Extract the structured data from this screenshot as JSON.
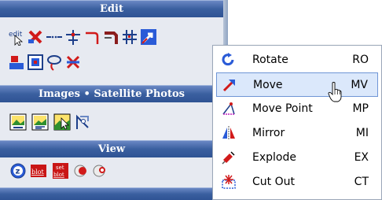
{
  "panel": {
    "sections": [
      {
        "title": "Edit"
      },
      {
        "title": "Images • Satellite Photos"
      },
      {
        "title": "View"
      }
    ],
    "view_icons": {
      "blot1": "blot",
      "blot2_top": "set",
      "blot2_bottom": "blot",
      "zoom": "z"
    },
    "edit_icon_text": "edit"
  },
  "context_menu": {
    "items": [
      {
        "label": "Rotate",
        "shortcut": "RO",
        "icon": "rotate-icon"
      },
      {
        "label": "Move",
        "shortcut": "MV",
        "icon": "move-icon",
        "selected": true
      },
      {
        "label": "Move Point",
        "shortcut": "MP",
        "icon": "move-point-icon"
      },
      {
        "label": "Mirror",
        "shortcut": "MI",
        "icon": "mirror-icon"
      },
      {
        "label": "Explode",
        "shortcut": "EX",
        "icon": "explode-icon"
      },
      {
        "label": "Cut Out",
        "shortcut": "CT",
        "icon": "cut-out-icon"
      }
    ]
  },
  "colors": {
    "header": "#3a5f9f",
    "selection": "#dbe8fb",
    "selection_border": "#6f95d6"
  }
}
